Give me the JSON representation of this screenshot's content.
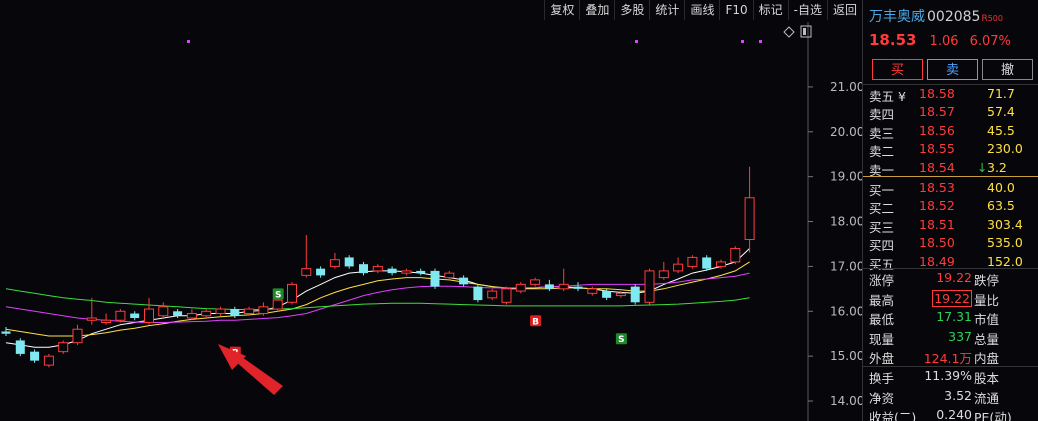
{
  "toolbar": {
    "buttons": [
      "复权",
      "叠加",
      "多股",
      "统计",
      "画线",
      "F10",
      "标记",
      "-自选",
      "返回"
    ]
  },
  "stock": {
    "name": "万丰奥威",
    "code": "002085",
    "badge": "R",
    "badge_num": "500",
    "price": "18.53",
    "change": "1.06",
    "change_pct": "6.07%"
  },
  "trade_buttons": {
    "buy": "买",
    "sell": "卖",
    "cancel": "撤"
  },
  "order_book": {
    "asks": [
      {
        "label": "卖五 ¥",
        "price": "18.58",
        "vol": "71.7"
      },
      {
        "label": "卖四",
        "price": "18.57",
        "vol": "57.4"
      },
      {
        "label": "卖三",
        "price": "18.56",
        "vol": "45.5"
      },
      {
        "label": "卖二",
        "price": "18.55",
        "vol": "230.0"
      },
      {
        "label": "卖一",
        "price": "18.54",
        "vol": "3.2",
        "arrow": "↓"
      }
    ],
    "bids": [
      {
        "label": "买一",
        "price": "18.53",
        "vol": "40.0"
      },
      {
        "label": "买二",
        "price": "18.52",
        "vol": "63.5"
      },
      {
        "label": "买三",
        "price": "18.51",
        "vol": "303.4"
      },
      {
        "label": "买四",
        "price": "18.50",
        "vol": "535.0"
      },
      {
        "label": "买五",
        "price": "18.49",
        "vol": "152.0"
      }
    ]
  },
  "stats": {
    "block1": [
      {
        "l1": "涨停",
        "v": "19.22",
        "color": "red",
        "l2": "跌停"
      },
      {
        "l1": "最高",
        "v": "19.22",
        "color": "red",
        "boxed": true,
        "l2": "量比"
      },
      {
        "l1": "最低",
        "v": "17.31",
        "color": "green",
        "l2": "市值"
      },
      {
        "l1": "现量",
        "v": "337",
        "color": "green",
        "l2": "总量"
      },
      {
        "l1": "外盘",
        "v": "124.1万",
        "color": "red",
        "l2": "内盘"
      }
    ],
    "block2": [
      {
        "l1": "换手",
        "v": "11.39%",
        "color": "white",
        "l2": "股本"
      },
      {
        "l1": "净资",
        "v": "3.52",
        "color": "white",
        "l2": "流通"
      },
      {
        "l1": "收益(二)",
        "v": "0.240",
        "color": "white",
        "l2": "PE(动)"
      }
    ]
  },
  "chart_data": {
    "type": "candlestick",
    "y_ticks": [
      "21.00",
      "20.00",
      "19.00",
      "18.00",
      "17.00",
      "16.00",
      "15.00",
      "14.00"
    ],
    "ylim": [
      13.8,
      21.6
    ],
    "colors": {
      "up": "#ff3b3b",
      "down": "#7fe8f0",
      "ma1": "#ffffff",
      "ma2": "#ffe042",
      "ma3": "#e040ff",
      "ma4": "#3adf3a"
    },
    "markers": [
      {
        "text": "S",
        "index": 19,
        "y": 16.4,
        "color": "#1f8a2a"
      },
      {
        "text": "B",
        "index": 16,
        "y": 15.1,
        "color": "#d91f1f"
      },
      {
        "text": "B",
        "index": 37,
        "y": 15.8,
        "color": "#d91f1f"
      },
      {
        "text": "S",
        "index": 43,
        "y": 15.4,
        "color": "#1f8a2a"
      }
    ],
    "candles": [
      {
        "o": 15.55,
        "c": 15.5,
        "h": 15.65,
        "l": 15.45
      },
      {
        "o": 15.35,
        "c": 15.05,
        "h": 15.4,
        "l": 15.0
      },
      {
        "o": 15.1,
        "c": 14.9,
        "h": 15.15,
        "l": 14.85
      },
      {
        "o": 14.8,
        "c": 15.0,
        "h": 15.05,
        "l": 14.75
      },
      {
        "o": 15.1,
        "c": 15.3,
        "h": 15.35,
        "l": 15.05
      },
      {
        "o": 15.3,
        "c": 15.6,
        "h": 15.7,
        "l": 15.25
      },
      {
        "o": 15.8,
        "c": 15.85,
        "h": 16.3,
        "l": 15.7
      },
      {
        "o": 15.75,
        "c": 15.8,
        "h": 15.95,
        "l": 15.7
      },
      {
        "o": 15.8,
        "c": 16.0,
        "h": 16.05,
        "l": 15.75
      },
      {
        "o": 15.95,
        "c": 15.85,
        "h": 16.0,
        "l": 15.8
      },
      {
        "o": 15.75,
        "c": 16.05,
        "h": 16.3,
        "l": 15.7
      },
      {
        "o": 15.9,
        "c": 16.1,
        "h": 16.2,
        "l": 15.85
      },
      {
        "o": 16.0,
        "c": 15.9,
        "h": 16.05,
        "l": 15.85
      },
      {
        "o": 15.85,
        "c": 15.95,
        "h": 16.05,
        "l": 15.8
      },
      {
        "o": 15.9,
        "c": 16.0,
        "h": 16.05,
        "l": 15.85
      },
      {
        "o": 15.95,
        "c": 16.05,
        "h": 16.1,
        "l": 15.9
      },
      {
        "o": 16.05,
        "c": 15.9,
        "h": 16.1,
        "l": 15.85
      },
      {
        "o": 15.95,
        "c": 16.05,
        "h": 16.1,
        "l": 15.9
      },
      {
        "o": 15.95,
        "c": 16.1,
        "h": 16.2,
        "l": 15.9
      },
      {
        "o": 16.05,
        "c": 16.25,
        "h": 16.35,
        "l": 16.0
      },
      {
        "o": 16.2,
        "c": 16.6,
        "h": 16.65,
        "l": 16.15
      },
      {
        "o": 16.8,
        "c": 16.95,
        "h": 17.7,
        "l": 16.75
      },
      {
        "o": 16.95,
        "c": 16.8,
        "h": 17.0,
        "l": 16.75
      },
      {
        "o": 17.0,
        "c": 17.15,
        "h": 17.3,
        "l": 16.95
      },
      {
        "o": 17.2,
        "c": 17.0,
        "h": 17.25,
        "l": 16.95
      },
      {
        "o": 17.05,
        "c": 16.85,
        "h": 17.1,
        "l": 16.8
      },
      {
        "o": 16.9,
        "c": 17.0,
        "h": 17.05,
        "l": 16.85
      },
      {
        "o": 16.95,
        "c": 16.85,
        "h": 17.0,
        "l": 16.8
      },
      {
        "o": 16.85,
        "c": 16.9,
        "h": 16.95,
        "l": 16.8
      },
      {
        "o": 16.9,
        "c": 16.85,
        "h": 16.95,
        "l": 16.8
      },
      {
        "o": 16.9,
        "c": 16.55,
        "h": 16.95,
        "l": 16.5
      },
      {
        "o": 16.75,
        "c": 16.85,
        "h": 16.9,
        "l": 16.7
      },
      {
        "o": 16.75,
        "c": 16.6,
        "h": 16.8,
        "l": 16.55
      },
      {
        "o": 16.55,
        "c": 16.25,
        "h": 16.6,
        "l": 16.2
      },
      {
        "o": 16.3,
        "c": 16.45,
        "h": 16.5,
        "l": 16.25
      },
      {
        "o": 16.2,
        "c": 16.5,
        "h": 16.55,
        "l": 16.15
      },
      {
        "o": 16.45,
        "c": 16.6,
        "h": 16.65,
        "l": 16.4
      },
      {
        "o": 16.6,
        "c": 16.7,
        "h": 16.75,
        "l": 16.55
      },
      {
        "o": 16.6,
        "c": 16.5,
        "h": 16.7,
        "l": 16.45
      },
      {
        "o": 16.5,
        "c": 16.6,
        "h": 16.95,
        "l": 16.45
      },
      {
        "o": 16.55,
        "c": 16.5,
        "h": 16.65,
        "l": 16.45
      },
      {
        "o": 16.4,
        "c": 16.5,
        "h": 16.55,
        "l": 16.35
      },
      {
        "o": 16.45,
        "c": 16.3,
        "h": 16.5,
        "l": 16.25
      },
      {
        "o": 16.35,
        "c": 16.4,
        "h": 16.45,
        "l": 16.3
      },
      {
        "o": 16.55,
        "c": 16.2,
        "h": 16.6,
        "l": 16.15
      },
      {
        "o": 16.2,
        "c": 16.9,
        "h": 16.95,
        "l": 16.15
      },
      {
        "o": 16.75,
        "c": 16.9,
        "h": 17.1,
        "l": 16.7
      },
      {
        "o": 16.9,
        "c": 17.05,
        "h": 17.2,
        "l": 16.85
      },
      {
        "o": 17.0,
        "c": 17.2,
        "h": 17.25,
        "l": 16.95
      },
      {
        "o": 17.2,
        "c": 16.95,
        "h": 17.25,
        "l": 16.9
      },
      {
        "o": 17.0,
        "c": 17.1,
        "h": 17.15,
        "l": 16.95
      },
      {
        "o": 17.1,
        "c": 17.4,
        "h": 17.45,
        "l": 17.05
      },
      {
        "o": 17.6,
        "c": 18.53,
        "h": 19.22,
        "l": 17.31
      }
    ],
    "ma_series": [
      {
        "color": "#ffffff",
        "values": [
          15.3,
          15.25,
          15.2,
          15.2,
          15.25,
          15.35,
          15.5,
          15.6,
          15.7,
          15.75,
          15.8,
          15.85,
          15.9,
          15.9,
          15.95,
          15.95,
          15.95,
          16.0,
          16.02,
          16.1,
          16.25,
          16.45,
          16.6,
          16.75,
          16.85,
          16.88,
          16.9,
          16.9,
          16.88,
          16.85,
          16.8,
          16.75,
          16.7,
          16.6,
          16.55,
          16.5,
          16.5,
          16.52,
          16.55,
          16.55,
          16.52,
          16.5,
          16.45,
          16.42,
          16.4,
          16.45,
          16.6,
          16.72,
          16.85,
          16.92,
          17.0,
          17.1,
          17.4
        ]
      },
      {
        "color": "#ffe042",
        "values": [
          15.6,
          15.55,
          15.5,
          15.45,
          15.45,
          15.45,
          15.48,
          15.52,
          15.58,
          15.62,
          15.68,
          15.72,
          15.78,
          15.82,
          15.85,
          15.88,
          15.9,
          15.92,
          15.95,
          16.0,
          16.05,
          16.15,
          16.3,
          16.42,
          16.52,
          16.6,
          16.68,
          16.72,
          16.75,
          16.75,
          16.72,
          16.7,
          16.65,
          16.6,
          16.55,
          16.52,
          16.5,
          16.5,
          16.5,
          16.52,
          16.52,
          16.5,
          16.5,
          16.48,
          16.45,
          16.45,
          16.5,
          16.58,
          16.65,
          16.72,
          16.8,
          16.9,
          17.1
        ]
      },
      {
        "color": "#e040ff",
        "values": [
          16.1,
          16.05,
          16.0,
          15.95,
          15.9,
          15.85,
          15.82,
          15.8,
          15.78,
          15.76,
          15.75,
          15.75,
          15.76,
          15.77,
          15.78,
          15.8,
          15.8,
          15.82,
          15.84,
          15.86,
          15.9,
          15.95,
          16.05,
          16.15,
          16.25,
          16.35,
          16.42,
          16.48,
          16.52,
          16.55,
          16.56,
          16.56,
          16.55,
          16.53,
          16.52,
          16.52,
          16.52,
          16.53,
          16.55,
          16.56,
          16.58,
          16.6,
          16.6,
          16.6,
          16.6,
          16.6,
          16.62,
          16.65,
          16.7,
          16.72,
          16.75,
          16.78,
          16.85
        ]
      },
      {
        "color": "#3adf3a",
        "values": [
          16.5,
          16.45,
          16.4,
          16.35,
          16.3,
          16.27,
          16.24,
          16.2,
          16.18,
          16.16,
          16.14,
          16.12,
          16.1,
          16.08,
          16.06,
          16.05,
          16.04,
          16.04,
          16.04,
          16.05,
          16.06,
          16.08,
          16.1,
          16.12,
          16.14,
          16.16,
          16.17,
          16.18,
          16.18,
          16.18,
          16.17,
          16.16,
          16.15,
          16.14,
          16.13,
          16.12,
          16.12,
          16.12,
          16.12,
          16.12,
          16.12,
          16.12,
          16.12,
          16.12,
          16.13,
          16.14,
          16.15,
          16.16,
          16.18,
          16.2,
          16.22,
          16.25,
          16.3
        ]
      }
    ]
  }
}
